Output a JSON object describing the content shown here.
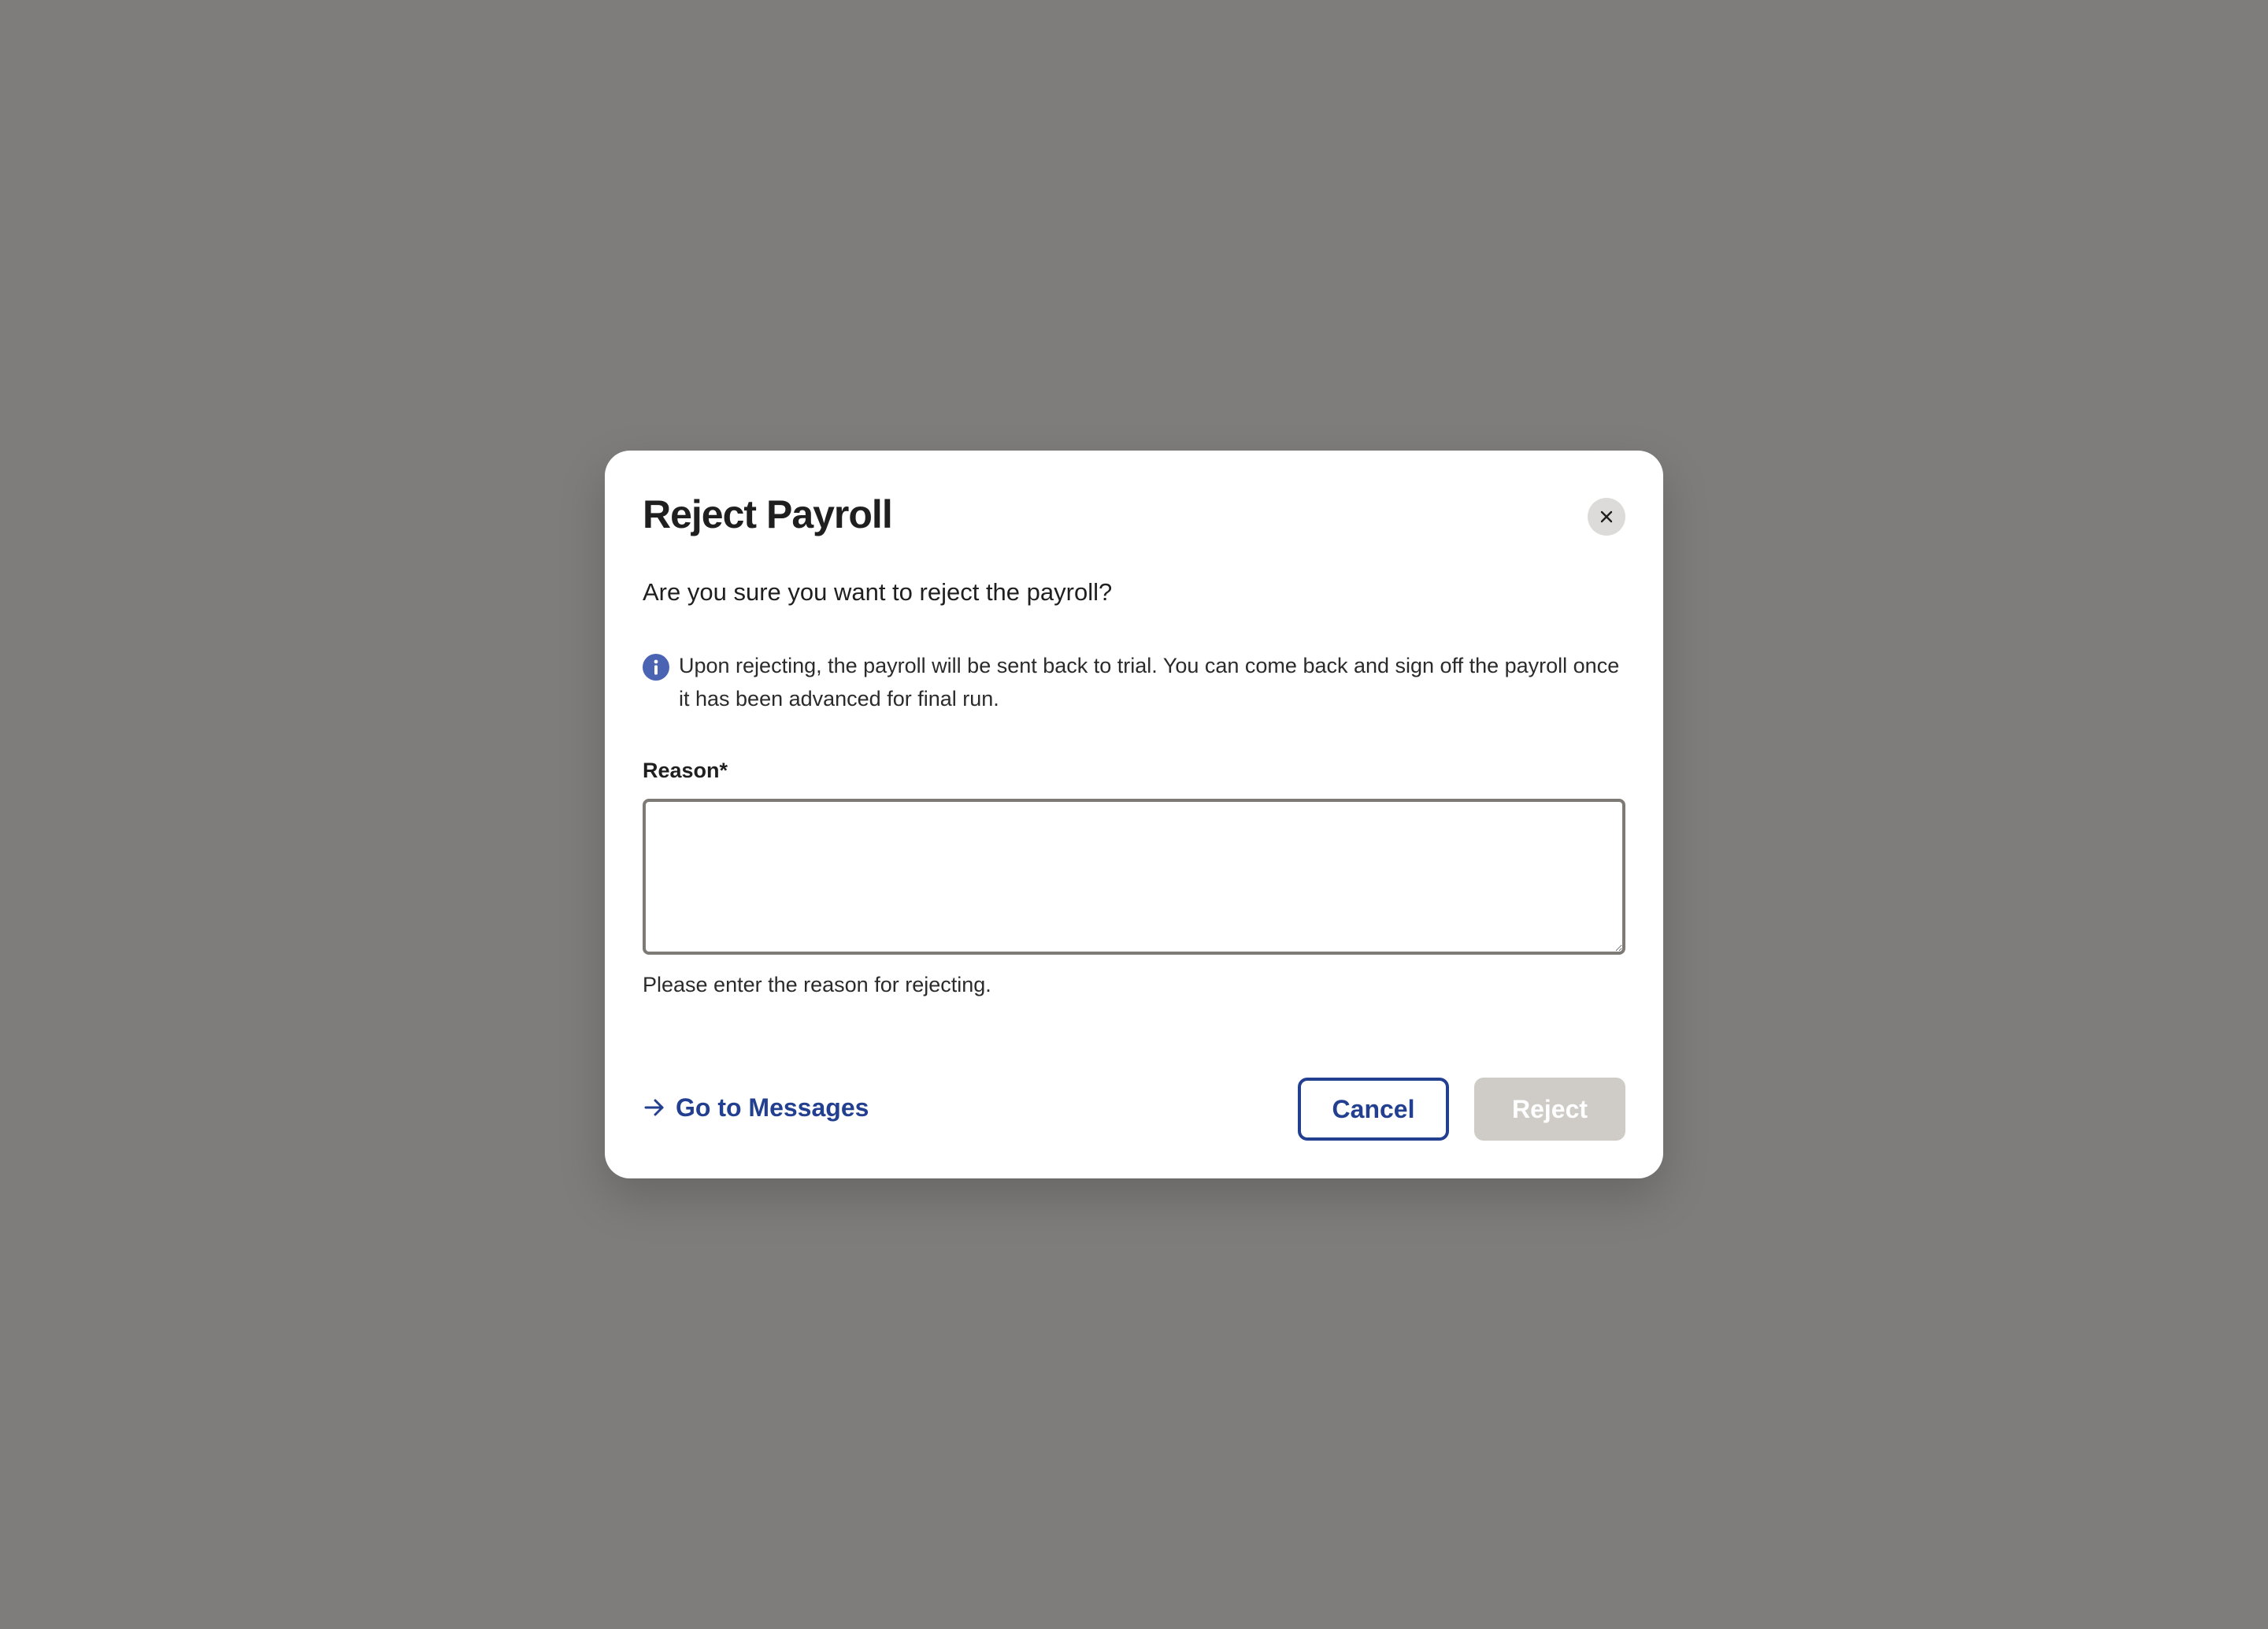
{
  "colors": {
    "backdrop": "#7e7d7b",
    "accent": "#233f8f",
    "info_icon": "#4a63b3",
    "disabled_button": "#cfcbc7"
  },
  "modal": {
    "title": "Reject Payroll",
    "close_icon": "close-icon",
    "question": "Are you sure you want to reject the payroll?",
    "info": {
      "icon": "info-icon",
      "text": "Upon rejecting, the payroll will be sent back to trial. You can come back and sign off the payroll once it has been advanced for final run."
    },
    "reason": {
      "label": "Reason*",
      "value": "",
      "placeholder": "",
      "helper_text": "Please enter the reason for rejecting."
    },
    "footer": {
      "link_icon": "arrow-right-icon",
      "link_label": "Go to Messages",
      "cancel_label": "Cancel",
      "reject_label": "Reject",
      "reject_disabled": true
    }
  }
}
